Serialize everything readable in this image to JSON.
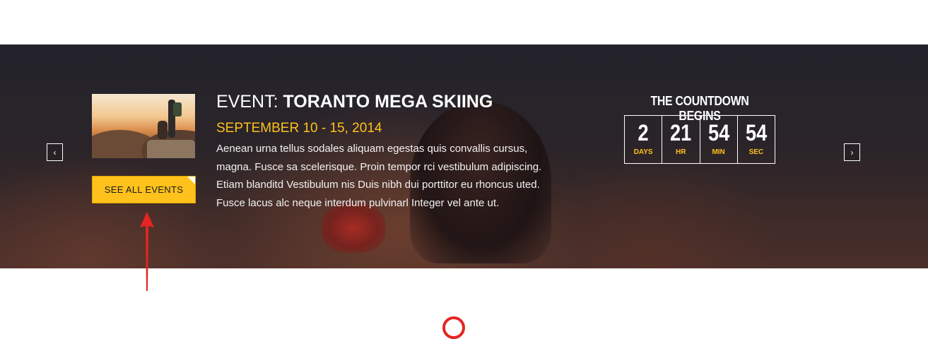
{
  "event": {
    "prefix": "EVENT:",
    "name": "TORANTO MEGA SKIING",
    "date": "SEPTEMBER 10 - 15, 2014",
    "description_lines": [
      "Aenean urna tellus sodales aliquam egestas quis convallis cursus,",
      "magna. Fusce sa scelerisque. Proin tempor rci vestibulum adipiscing.",
      "Etiam blanditd Vestibulum nis Duis nibh dui porttitor eu rhoncus uted.",
      "Fusce lacus alc neque interdum pulvinarl Integer vel ante ut."
    ]
  },
  "buttons": {
    "see_all_events": "SEE ALL EVENTS",
    "prev_glyph": "‹",
    "next_glyph": "›"
  },
  "countdown": {
    "title": "THE COUNTDOWN BEGINS",
    "units": [
      {
        "value": "2",
        "label": "DAYS"
      },
      {
        "value": "21",
        "label": "HR"
      },
      {
        "value": "54",
        "label": "MIN"
      },
      {
        "value": "54",
        "label": "SEC"
      }
    ]
  },
  "colors": {
    "accent": "#ffc11c",
    "annotation": "#e52521"
  },
  "icons": {
    "prev": "chevron-left-icon",
    "next": "chevron-right-icon",
    "annotation": "arrow-up-icon"
  }
}
